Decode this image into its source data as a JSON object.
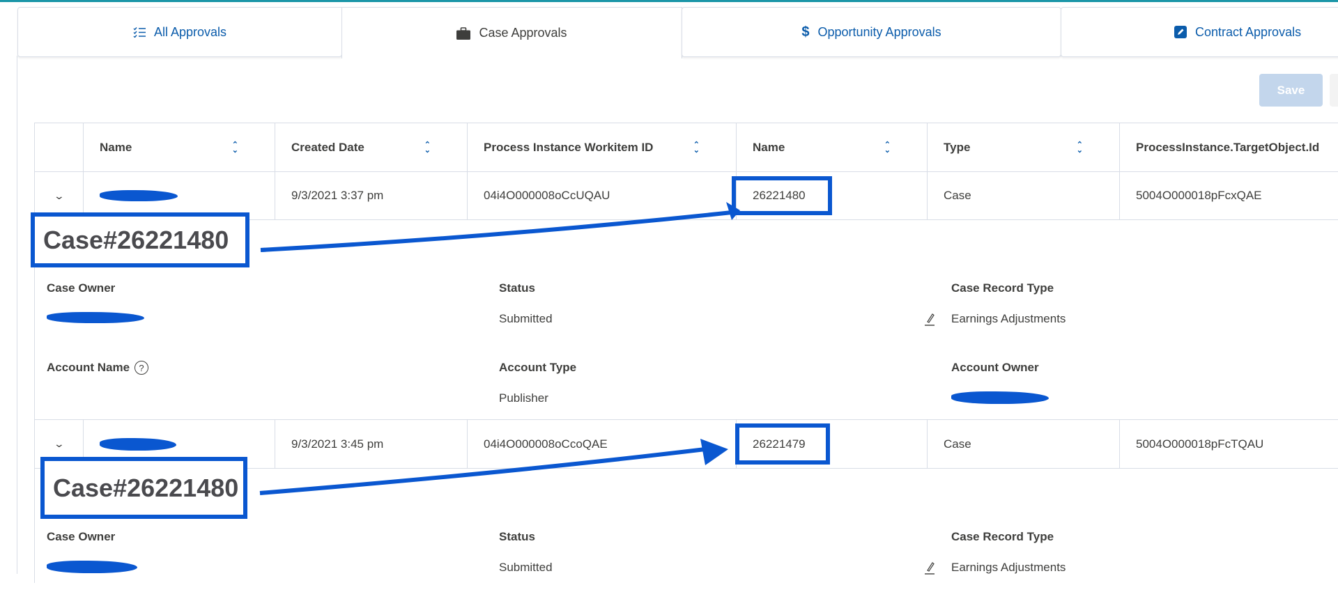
{
  "tabs": [
    {
      "label": "All Approvals",
      "icon": "checklist-icon",
      "active": false
    },
    {
      "label": "Case Approvals",
      "icon": "briefcase-icon",
      "active": true
    },
    {
      "label": "Opportunity Approvals",
      "icon": "dollar-icon",
      "active": false
    },
    {
      "label": "Contract Approvals",
      "icon": "edit-contract-icon",
      "active": false
    }
  ],
  "toolbar": {
    "save_label": "Save"
  },
  "table": {
    "columns": [
      "Name",
      "Created Date",
      "Process Instance Workitem ID",
      "Name",
      "Type",
      "ProcessInstance.TargetObject.Id"
    ],
    "rows": [
      {
        "name": "[redacted]",
        "created_date": "9/3/2021 3:37 pm",
        "workitem_id": "04i4O000008oCcUQAU",
        "case_number": "26221480",
        "type": "Case",
        "target_id": "5004O000018pFcxQAE",
        "detail": {
          "case_owner_label": "Case Owner",
          "case_owner": "[redacted]",
          "status_label": "Status",
          "status": "Submitted",
          "record_type_label": "Case Record Type",
          "record_type": "Earnings Adjustments",
          "account_name_label": "Account Name",
          "account_name": "",
          "account_type_label": "Account Type",
          "account_type": "Publisher",
          "account_owner_label": "Account Owner",
          "account_owner": "[redacted]"
        }
      },
      {
        "name": "[redacted]",
        "created_date": "9/3/2021 3:45 pm",
        "workitem_id": "04i4O000008oCcoQAE",
        "case_number": "26221479",
        "type": "Case",
        "target_id": "5004O000018pFcTQAU",
        "detail": {
          "case_owner_label": "Case Owner",
          "case_owner": "[redacted]",
          "status_label": "Status",
          "status": "Submitted",
          "record_type_label": "Case Record Type",
          "record_type": "Earnings Adjustments"
        }
      }
    ]
  },
  "annotations": [
    {
      "text": "Case#26221480",
      "points_to": "26221480"
    },
    {
      "text": "Case#26221480",
      "points_to": "26221479"
    }
  ],
  "colors": {
    "accent": "#0b5cab",
    "annotation": "#0a57d0",
    "save_disabled": "#c3d6ec",
    "topline": "#1b96a8"
  }
}
